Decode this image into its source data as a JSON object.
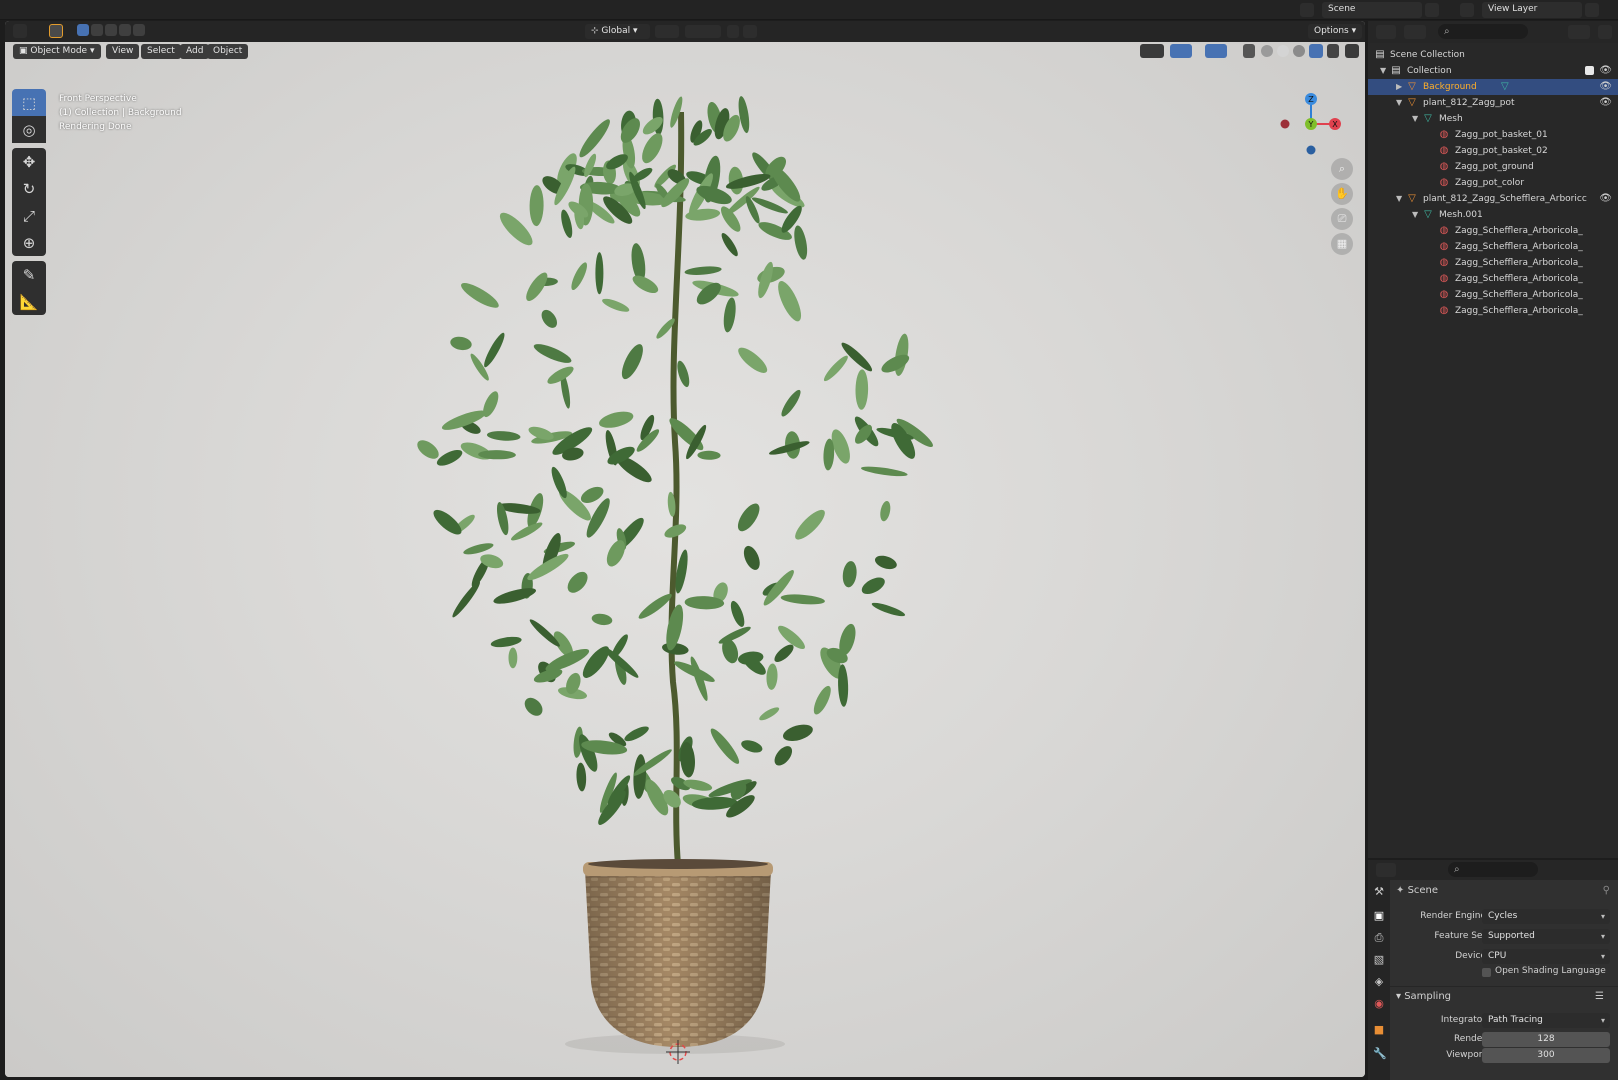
{
  "topbar": {
    "scene_label": "Scene",
    "view_layer_label": "View Layer"
  },
  "viewport": {
    "mode": "Object Mode",
    "menus": [
      "View",
      "Select",
      "Add",
      "Object"
    ],
    "transform_orientation": "Global",
    "options_label": "Options",
    "overlay_lines": [
      "Front Perspective",
      "(1) Collection | Background",
      "Rendering Done"
    ],
    "gizmo_axes": {
      "z": "Z",
      "y": "Y",
      "x": "X"
    }
  },
  "outliner": {
    "scene_collection": "Scene Collection",
    "rows": [
      {
        "label": "Collection",
        "type": "collection",
        "depth": 1,
        "expanded": true
      },
      {
        "label": "Background",
        "type": "object",
        "depth": 2,
        "expanded": false,
        "selected": true
      },
      {
        "label": "plant_812_Zagg_pot",
        "type": "object",
        "depth": 2,
        "expanded": true
      },
      {
        "label": "Mesh",
        "type": "mesh",
        "depth": 3,
        "expanded": true
      },
      {
        "label": "Zagg_pot_basket_01",
        "type": "material",
        "depth": 4
      },
      {
        "label": "Zagg_pot_basket_02",
        "type": "material",
        "depth": 4
      },
      {
        "label": "Zagg_pot_ground",
        "type": "material",
        "depth": 4
      },
      {
        "label": "Zagg_pot_color",
        "type": "material",
        "depth": 4
      },
      {
        "label": "plant_812_Zagg_Schefflera_Arboricc",
        "type": "object",
        "depth": 2,
        "expanded": true
      },
      {
        "label": "Mesh.001",
        "type": "mesh",
        "depth": 3,
        "expanded": true
      },
      {
        "label": "Zagg_Schefflera_Arboricola_",
        "type": "material",
        "depth": 4
      },
      {
        "label": "Zagg_Schefflera_Arboricola_",
        "type": "material",
        "depth": 4
      },
      {
        "label": "Zagg_Schefflera_Arboricola_",
        "type": "material",
        "depth": 4
      },
      {
        "label": "Zagg_Schefflera_Arboricola_",
        "type": "material",
        "depth": 4
      },
      {
        "label": "Zagg_Schefflera_Arboricola_",
        "type": "material",
        "depth": 4
      },
      {
        "label": "Zagg_Schefflera_Arboricola_",
        "type": "material",
        "depth": 4
      }
    ]
  },
  "properties": {
    "context": "Scene",
    "render_engine_label": "Render Engine",
    "render_engine": "Cycles",
    "feature_set_label": "Feature Set",
    "feature_set": "Supported",
    "device_label": "Device",
    "device": "CPU",
    "osl_label": "Open Shading Language",
    "sampling_label": "Sampling",
    "integrator_label": "Integrator",
    "integrator": "Path Tracing",
    "render_samples_label": "Render",
    "render_samples": "128",
    "viewport_samples_label": "Viewport",
    "viewport_samples": "300"
  },
  "colors": {
    "selection_blue": "#4772b3",
    "object_orange": "#e88e35",
    "material_red": "#e05959",
    "mesh_teal": "#3fb7a2",
    "viewport_background": "#d5d4d2",
    "foliage_green": "#4e7a43",
    "pot_wicker": "#a58865"
  }
}
